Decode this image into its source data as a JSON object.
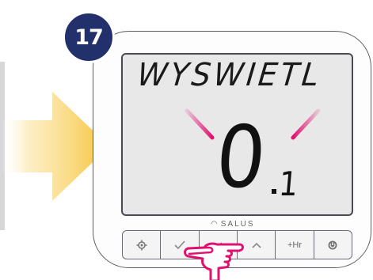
{
  "step": {
    "number": "17"
  },
  "display": {
    "label": "WYSWIETL",
    "value_main": "0",
    "value_sub": "1"
  },
  "brand": {
    "name": "SALUS"
  },
  "buttons": [
    {
      "id": "settings",
      "icon": "gear-icon",
      "label": ""
    },
    {
      "id": "confirm",
      "icon": "check-icon",
      "label": ""
    },
    {
      "id": "down",
      "icon": "chevron-down-icon",
      "label": ""
    },
    {
      "id": "up",
      "icon": "chevron-up-icon",
      "label": ""
    },
    {
      "id": "plus-hour",
      "icon": "",
      "label": "+Hr"
    },
    {
      "id": "power",
      "icon": "power-icon",
      "label": ""
    }
  ],
  "colors": {
    "badge": "#22306b",
    "flash": "#e0116f",
    "arrow": "#f7c234",
    "hand_outline": "#e0116f"
  }
}
